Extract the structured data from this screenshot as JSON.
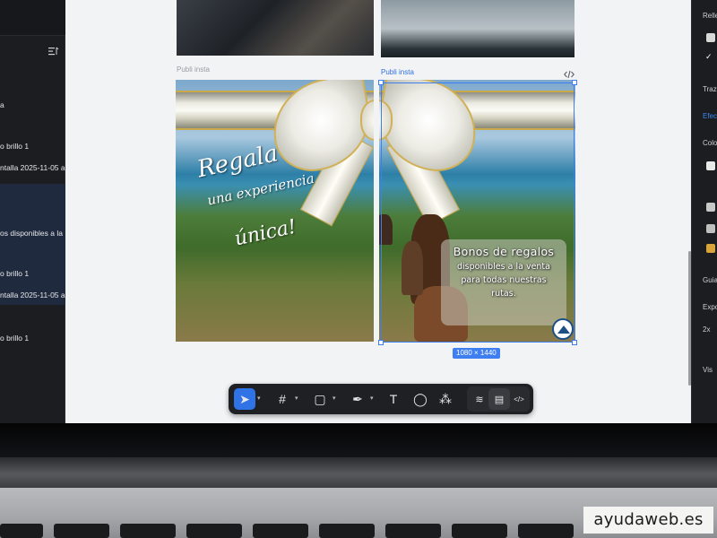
{
  "layers_panel": {
    "items": [
      {
        "label": "a"
      },
      {
        "label": "o brillo 1"
      },
      {
        "label": "ntalla 2025-11-05 a"
      },
      {
        "label": "os disponibles a la"
      },
      {
        "label": "o brillo 1"
      },
      {
        "label": "ntalla 2025-11-05 a"
      },
      {
        "label": "o brillo 1"
      }
    ]
  },
  "canvas": {
    "frame_label_left": "Publi insta",
    "frame_label_right": "Publi insta",
    "dimensions": "1080 × 1440",
    "poster": {
      "slogan_line1": "Regala",
      "slogan_line2": "una experiencia",
      "slogan_line3": "única!",
      "voucher_title": "Bonos de regalos",
      "voucher_line1": "disponibles a la venta",
      "voucher_line2": "para todas nuestras",
      "voucher_line3": "rutas."
    }
  },
  "toolbar": {
    "tools": [
      {
        "name": "move",
        "icon": "cursor-icon",
        "glyph": "➤",
        "active": true
      },
      {
        "name": "frame",
        "icon": "hash-frame-icon",
        "glyph": "#"
      },
      {
        "name": "shape",
        "icon": "rectangle-icon",
        "glyph": "▢"
      },
      {
        "name": "pen",
        "icon": "pen-icon",
        "glyph": "✒"
      },
      {
        "name": "text",
        "icon": "text-icon",
        "glyph": "T"
      },
      {
        "name": "comment",
        "icon": "comment-icon",
        "glyph": "◯"
      },
      {
        "name": "actions",
        "icon": "components-icon",
        "glyph": "⁂"
      }
    ],
    "sub_tools": [
      {
        "name": "draw",
        "icon": "draw-icon",
        "glyph": "≋"
      },
      {
        "name": "design",
        "icon": "design-mode-icon",
        "glyph": "▤"
      },
      {
        "name": "dev",
        "icon": "code-icon",
        "glyph": "</>"
      }
    ]
  },
  "right_panel": {
    "labels": [
      {
        "text": "Relle"
      },
      {
        "text": "Traz"
      },
      {
        "text": "Efec"
      },
      {
        "text": "Colo"
      },
      {
        "text": "Guia"
      },
      {
        "text": "Expo"
      },
      {
        "text": "2x"
      },
      {
        "text": "Vis"
      }
    ],
    "swatches": [
      "#d8d8d8",
      "#e8e8e8",
      "#c8c8c8",
      "#bfbfbf",
      "#d9a43a"
    ]
  },
  "watermark": {
    "text": "ayudaweb.es"
  }
}
